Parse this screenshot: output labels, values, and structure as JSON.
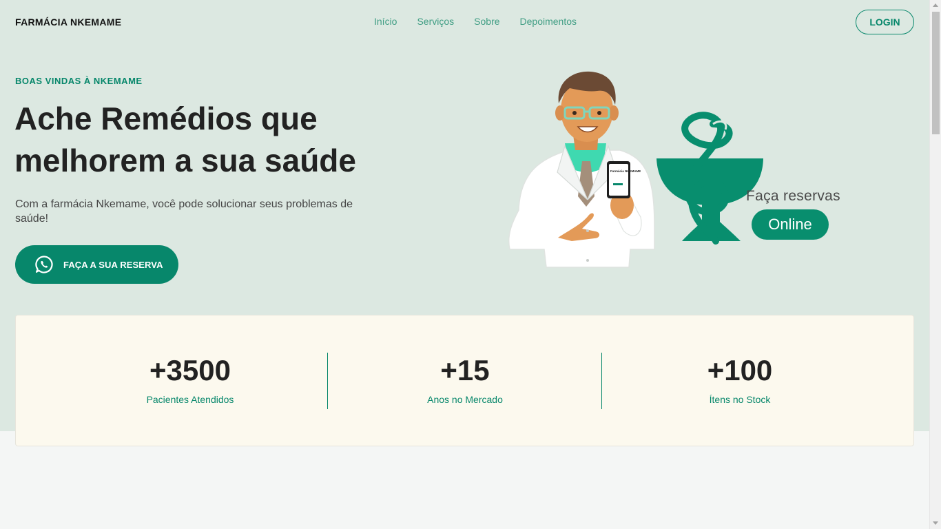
{
  "header": {
    "brand": "FARMÁCIA NKEMAME",
    "nav": [
      "Início",
      "Serviços",
      "Sobre",
      "Depoimentos"
    ],
    "login_label": "LOGIN"
  },
  "hero": {
    "eyebrow": "BOAS VINDAS À NKEMAME",
    "title": "Ache Remédios que melhorem a sua saúde",
    "lead": "Com a farmácia Nkemame, você pode solucionar seus problemas de saúde!",
    "cta_label": "FAÇA A SUA RESERVA",
    "cta_icon": "whatsapp-icon",
    "illustration": {
      "phone_text": "Farmácia NKEMAME",
      "tagline": "Faça reservas",
      "pill": "Online"
    }
  },
  "stats": [
    {
      "value": "+3500",
      "label": "Pacientes Atendidos"
    },
    {
      "value": "+15",
      "label": "Anos no Mercado"
    },
    {
      "value": "+100",
      "label": "Ítens no Stock"
    }
  ],
  "colors": {
    "primary": "#07876b",
    "hero_bg": "#dce8e1",
    "stats_bg": "#fcf9ee",
    "page_bg": "#f4f6f5"
  }
}
